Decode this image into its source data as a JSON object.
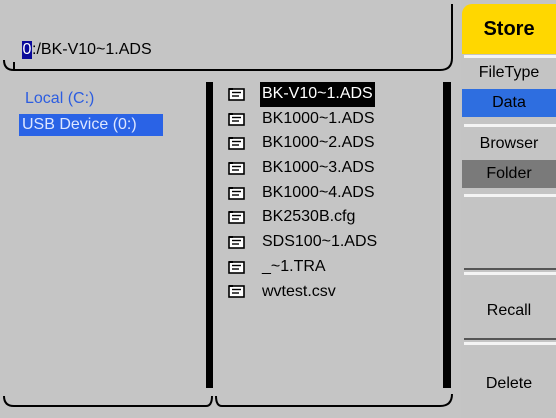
{
  "path": {
    "drive_char": "0",
    "rest": ":/BK-V10~1.ADS"
  },
  "drives": [
    {
      "label": "Local (C:)",
      "selected": false
    },
    {
      "label": "USB Device (0:)",
      "selected": true
    }
  ],
  "files": [
    {
      "name": "BK-V10~1.ADS",
      "selected": true
    },
    {
      "name": "BK1000~1.ADS",
      "selected": false
    },
    {
      "name": "BK1000~2.ADS",
      "selected": false
    },
    {
      "name": "BK1000~3.ADS",
      "selected": false
    },
    {
      "name": "BK1000~4.ADS",
      "selected": false
    },
    {
      "name": "BK2530B.cfg",
      "selected": false
    },
    {
      "name": "SDS100~1.ADS",
      "selected": false
    },
    {
      "name": "_~1.TRA",
      "selected": false
    },
    {
      "name": "wvtest.csv",
      "selected": false
    }
  ],
  "menu": {
    "title": "Store",
    "file_type_label": "FileType",
    "file_type_value": "Data",
    "browser_label": "Browser",
    "browser_value": "Folder",
    "empty_label": "",
    "recall_label": "Recall",
    "delete_label": "Delete"
  },
  "colors": {
    "title_bg": "#ffd700",
    "selected_blue": "#2e6ee0",
    "drive_text": "#2c5de0"
  },
  "icons": {
    "file": "document-icon"
  }
}
